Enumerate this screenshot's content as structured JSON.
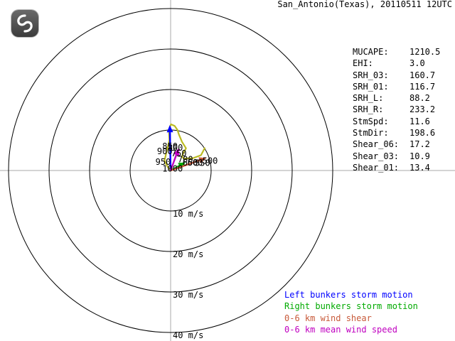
{
  "title": "San_Antonio(Texas), 20110511 12UTC",
  "logo": {
    "icon": "swirl-logo-icon"
  },
  "stats": [
    {
      "key": "MUCAPE:",
      "value": "1210.5"
    },
    {
      "key": "EHI:",
      "value": "3.0"
    },
    {
      "key": "SRH_03:",
      "value": "160.7"
    },
    {
      "key": "SRH_01:",
      "value": "116.7"
    },
    {
      "key": "SRH_L:",
      "value": "88.2"
    },
    {
      "key": "SRH_R:",
      "value": "233.2"
    },
    {
      "key": "StmSpd:",
      "value": "11.6"
    },
    {
      "key": "StmDir:",
      "value": "198.6"
    },
    {
      "key": "Shear_06:",
      "value": "17.2"
    },
    {
      "key": "Shear_03:",
      "value": "10.9"
    },
    {
      "key": "Shear_01:",
      "value": "13.4"
    }
  ],
  "legend": [
    {
      "label": "Left bunkers storm motion",
      "color": "#0000ff"
    },
    {
      "label": "Right bunkers storm motion",
      "color": "#00aa00"
    },
    {
      "label": "0-6 km wind shear",
      "color": "#c85a3a"
    },
    {
      "label": "0-6 km mean wind speed",
      "color": "#c000c0"
    }
  ],
  "chart_data": {
    "type": "hodograph",
    "ring_speeds": [
      10,
      20,
      30,
      40
    ],
    "ring_labels": [
      "10 m/s",
      "20 m/s",
      "30 m/s",
      "40 m/s"
    ],
    "axis_color": "#aaaaaa",
    "trace_color": "#bbbb22",
    "hodograph": [
      {
        "u": 0.0,
        "v": 0.0
      },
      {
        "u": -0.8,
        "v": 1.0
      },
      {
        "u": -1.0,
        "v": 1.4
      },
      {
        "u": -1.5,
        "v": 2.5
      },
      {
        "u": -1.2,
        "v": 3.8
      },
      {
        "u": -0.8,
        "v": 5.5
      },
      {
        "u": -0.3,
        "v": 7.5
      },
      {
        "u": -0.4,
        "v": 9.3
      },
      {
        "u": -0.2,
        "v": 10.8
      },
      {
        "u": 0.1,
        "v": 11.4
      },
      {
        "u": 1.0,
        "v": 11.0
      },
      {
        "u": 1.7,
        "v": 10.0
      },
      {
        "u": 2.0,
        "v": 9.0
      },
      {
        "u": 2.8,
        "v": 7.1
      },
      {
        "u": 3.8,
        "v": 5.5
      },
      {
        "u": 3.0,
        "v": 4.0
      },
      {
        "u": 2.8,
        "v": 3.4
      },
      {
        "u": 3.3,
        "v": 2.9
      },
      {
        "u": 4.2,
        "v": 3.0
      },
      {
        "u": 5.4,
        "v": 3.0
      },
      {
        "u": 7.0,
        "v": 3.6
      },
      {
        "u": 7.5,
        "v": 3.8
      },
      {
        "u": 8.4,
        "v": 5.5
      }
    ],
    "levels": [
      {
        "label": "1000",
        "u": -0.3,
        "v": 0.4
      },
      {
        "label": "950",
        "u": -2.0,
        "v": 2.1
      },
      {
        "label": "900",
        "u": -1.6,
        "v": 4.7
      },
      {
        "label": "850",
        "u": -0.3,
        "v": 6.0
      },
      {
        "label": "800",
        "u": 1.0,
        "v": 5.6
      },
      {
        "label": "750",
        "u": 1.9,
        "v": 4.2
      },
      {
        "label": "700",
        "u": 3.5,
        "v": 2.7
      },
      {
        "label": "650",
        "u": 4.7,
        "v": 1.9
      },
      {
        "label": "600",
        "u": 5.9,
        "v": 1.9
      },
      {
        "label": "550",
        "u": 7.7,
        "v": 1.8
      },
      {
        "label": "500",
        "u": 9.6,
        "v": 2.4
      }
    ],
    "vectors": [
      {
        "name": "Left bunkers storm motion",
        "color": "#0000ff",
        "u": -0.2,
        "v": 11.2
      },
      {
        "name": "Right bunkers storm motion",
        "color": "#00aa00",
        "u": 3.7,
        "v": 2.0
      },
      {
        "name": "0-6 km wind shear",
        "color": "#c85a3a",
        "u": 8.8,
        "v": 3.1
      },
      {
        "name": "0-6 km mean wind speed",
        "color": "#c000c0",
        "u": 2.0,
        "v": 5.5
      }
    ]
  }
}
